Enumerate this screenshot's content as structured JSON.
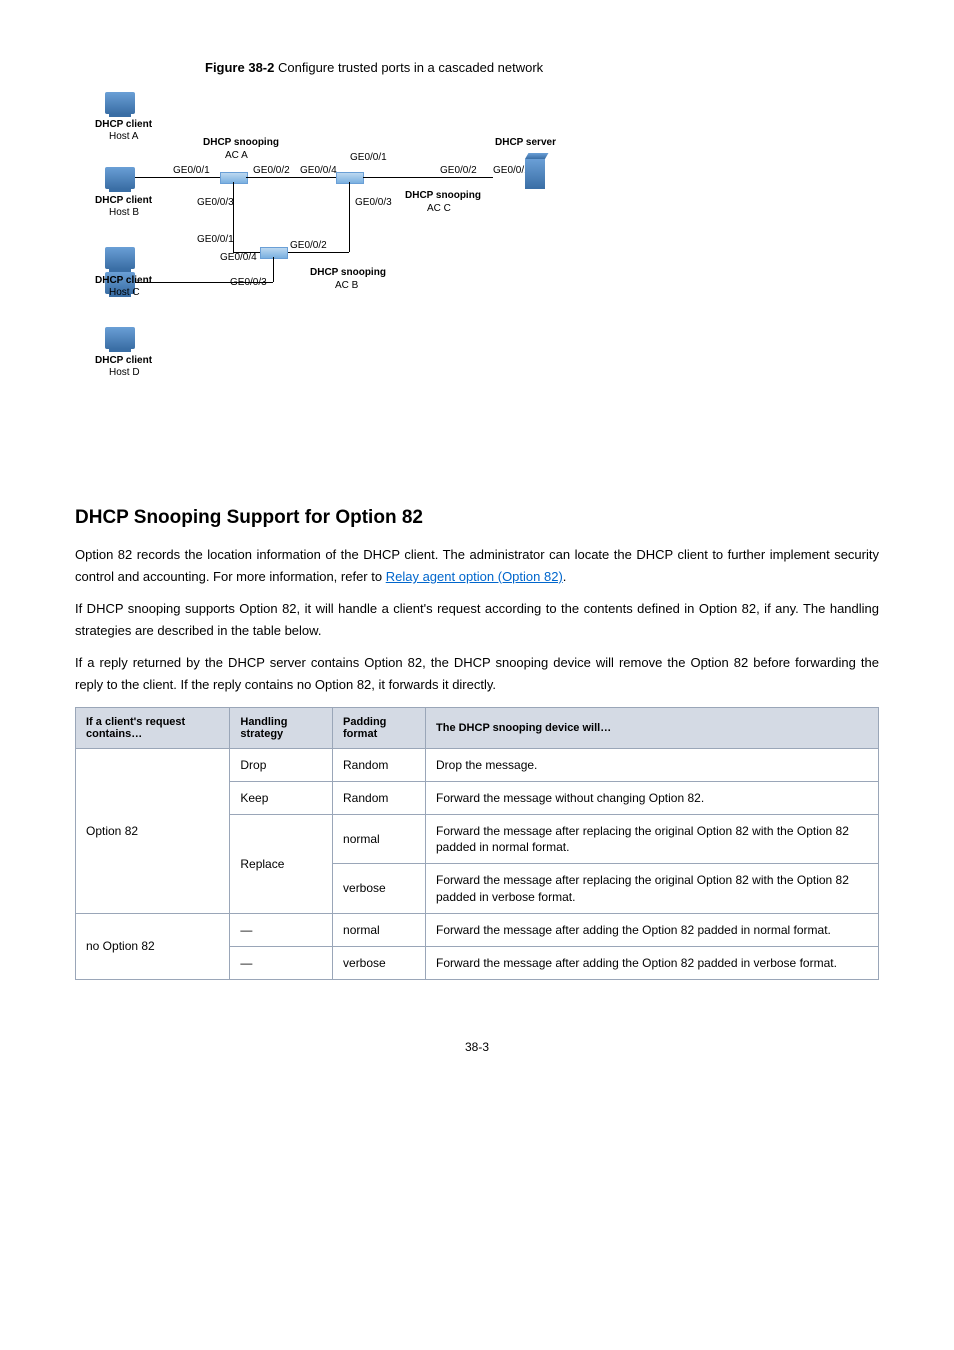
{
  "figure": {
    "prefix": "Figure 38-2",
    "caption": "Configure trusted ports in a cascaded network",
    "labels": {
      "dhcp_client": "DHCP client",
      "host_a": "Host A",
      "host_b": "Host B",
      "host_c": "Host C",
      "host_d": "Host D",
      "dhcp_snooping": "DHCP snooping",
      "ac_a": "AC A",
      "ac_b": "AC B",
      "ac_c": "AC C",
      "dhcp_server": "DHCP server",
      "ge001": "GE0/0/1",
      "ge002": "GE0/0/2",
      "ge003": "GE0/0/3",
      "ge004": "GE0/0/4"
    }
  },
  "section": {
    "title": "DHCP Snooping Support for Option 82",
    "p1a": "Option 82 records the location information of the DHCP client. The administrator can locate the DHCP client to further implement security control and accounting. For more information, refer to ",
    "p1link": "Relay agent option (Option 82)",
    "p1b": ".",
    "p2": "If DHCP snooping supports Option 82, it will handle a client's request according to the contents defined in Option 82, if any. The handling strategies are described in the table below.",
    "p3": "If a reply returned by the DHCP server contains Option 82, the DHCP snooping device will remove the Option 82 before forwarding the reply to the client. If the reply contains no Option 82, it forwards it directly."
  },
  "table": {
    "headers": [
      "If a client's request contains…",
      "Handling strategy",
      "Padding format",
      "The DHCP snooping device will…"
    ],
    "group1_label": "Option 82",
    "group2_label": "no Option 82",
    "dash": "—",
    "rows": {
      "r1": {
        "strategy": "Drop",
        "padding": "Random",
        "action": "Drop the message."
      },
      "r2": {
        "strategy": "Keep",
        "padding": "Random",
        "action": "Forward the message without changing Option 82."
      },
      "r3_strategy": "Replace",
      "r3": {
        "padding": "normal",
        "action": "Forward the message after replacing the original Option 82 with the Option 82 padded in normal format."
      },
      "r4": {
        "padding": "verbose",
        "action": "Forward the message after replacing the original Option 82 with the Option 82 padded in verbose format."
      },
      "r5": {
        "padding": "normal",
        "action": "Forward the message after adding the Option 82 padded in normal format."
      },
      "r6": {
        "padding": "verbose",
        "action": "Forward the message after adding the Option 82 padded in verbose format."
      }
    }
  },
  "footer": "38-3"
}
